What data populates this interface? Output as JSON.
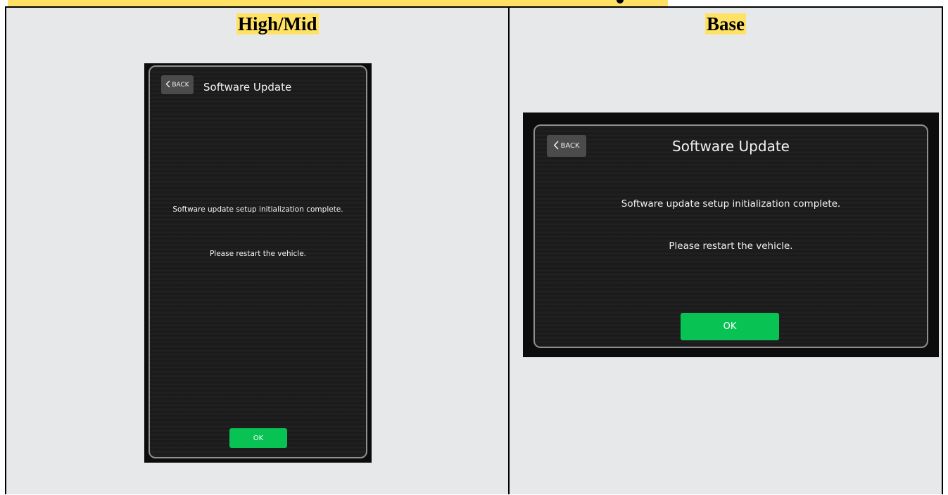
{
  "columns": [
    {
      "heading": "High/Mid",
      "screen": {
        "back_label": "BACK",
        "title": "Software Update",
        "message_line1": "Software update setup initialization complete.",
        "message_line2": "Please restart the vehicle.",
        "ok_label": "OK"
      }
    },
    {
      "heading": "Base",
      "screen": {
        "back_label": "BACK",
        "title": "Software Update",
        "message_line1": "Software update setup initialization complete.",
        "message_line2": "Please restart the vehicle.",
        "ok_label": "OK"
      }
    }
  ],
  "colors": {
    "highlight": "#ffe264",
    "ok_button": "#08c354",
    "panel_background": "#e7e8ea",
    "screen_background": "#0c0c0c"
  }
}
